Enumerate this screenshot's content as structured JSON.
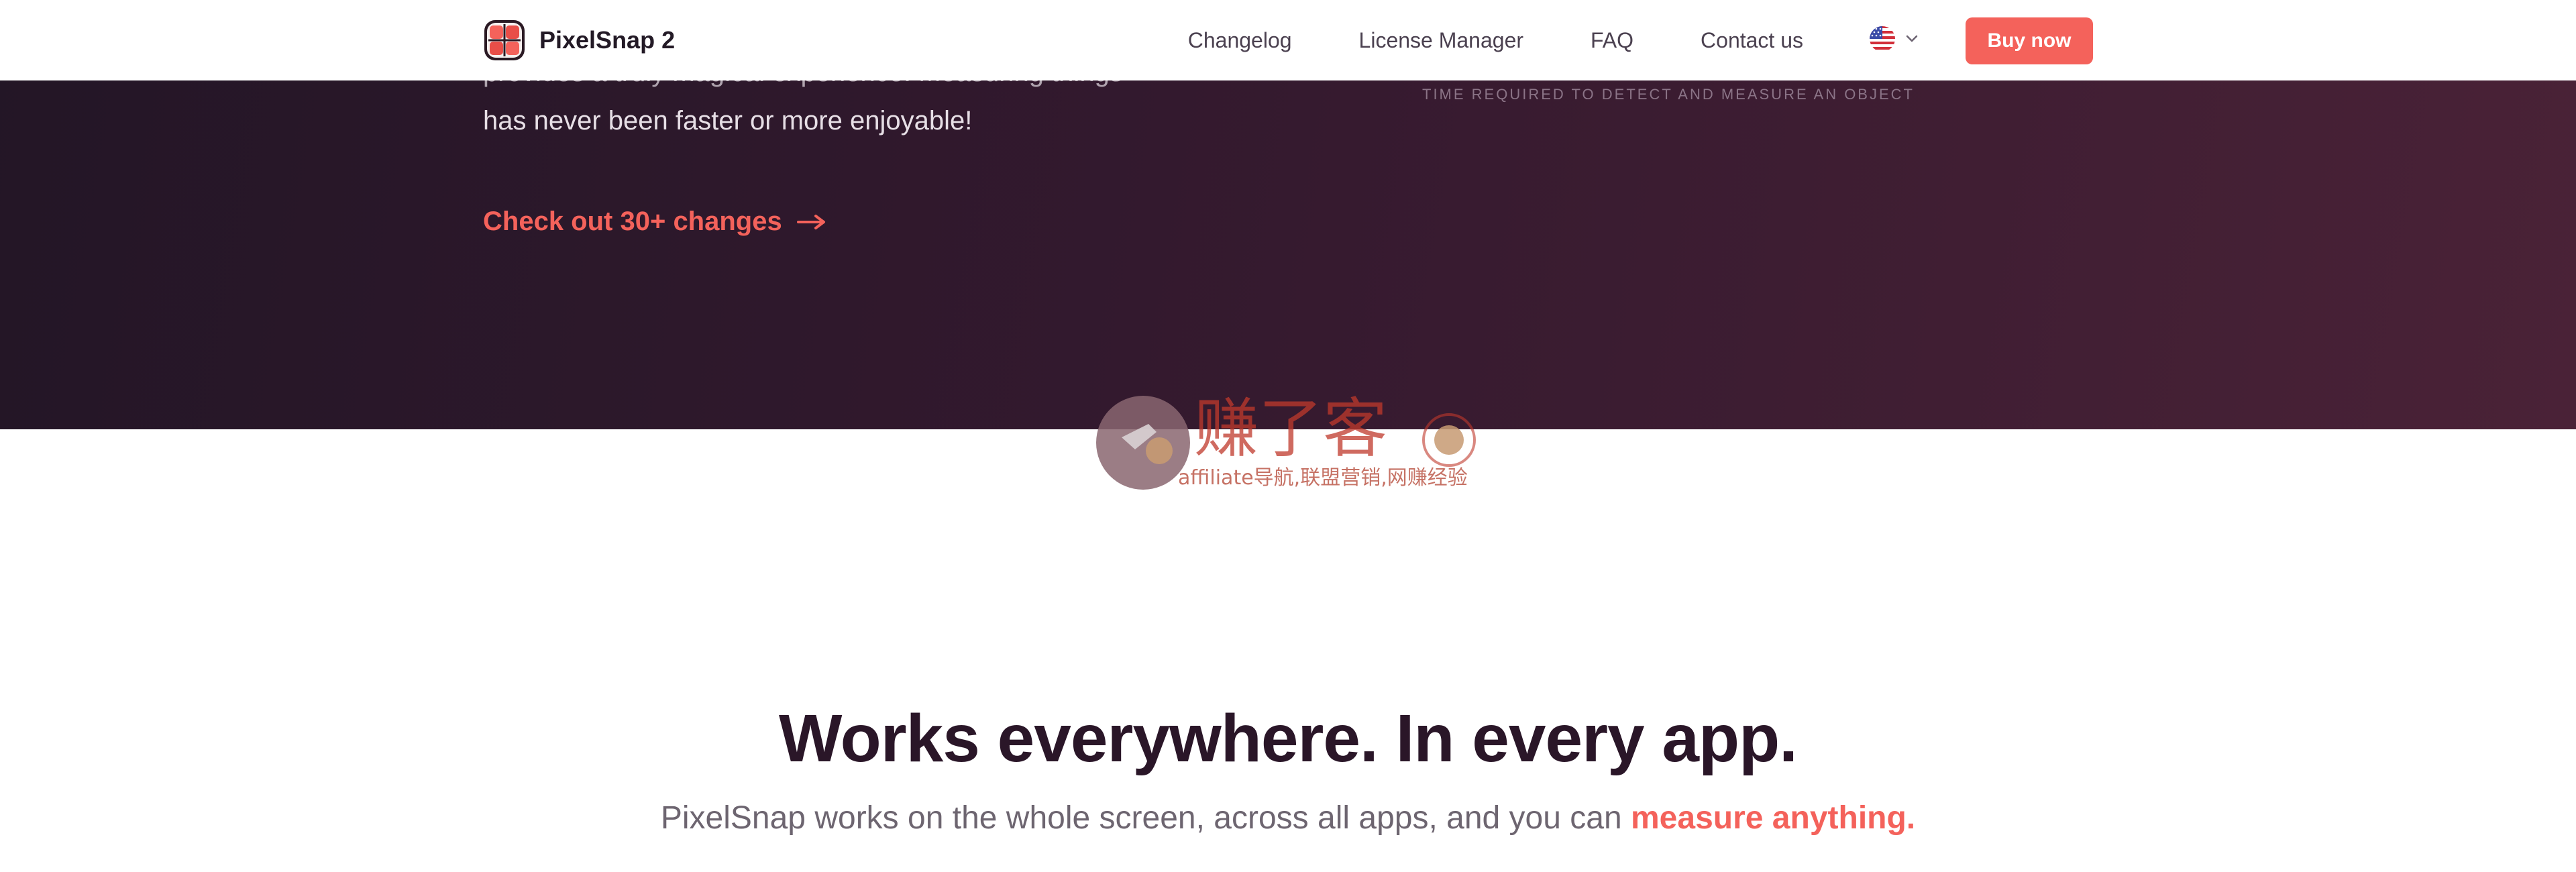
{
  "nav": {
    "brand": "PixelSnap 2",
    "links": [
      "Changelog",
      "License Manager",
      "FAQ",
      "Contact us"
    ],
    "language_icon": "us-flag-icon",
    "buy_label": "Buy now"
  },
  "hero": {
    "partial_line": "provides a truly magical experience. Measuring things",
    "line": "has never been faster or more enjoyable!",
    "changes_link": "Check out 30+ changes",
    "caption": "TIME REQUIRED TO DETECT AND MEASURE AN OBJECT"
  },
  "watermark": {
    "title": "赚了客",
    "subtitle": "affiliate导航,联盟营销,网赚经验"
  },
  "section": {
    "title": "Works everywhere. In every app.",
    "subtitle_prefix": "PixelSnap works on the whole screen, across all apps, and you can ",
    "subtitle_highlight": "measure anything."
  },
  "colors": {
    "accent": "#f4625b",
    "hero_dark": "#231626",
    "hero_light": "#4a2237",
    "heading": "#2a1628"
  }
}
